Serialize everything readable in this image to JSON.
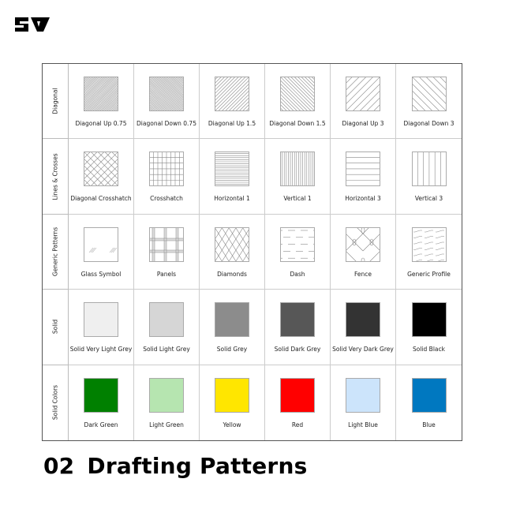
{
  "logo": {
    "text": "SA",
    "icon": "sa-logo-icon"
  },
  "title": {
    "number": "02",
    "text": "Drafting Patterns"
  },
  "rows": [
    {
      "label": "Diagonal",
      "items": [
        {
          "name": "Diagonal Up 0.75",
          "pattern": "diag-up",
          "spacing": 0.75
        },
        {
          "name": "Diagonal Down 0.75",
          "pattern": "diag-down",
          "spacing": 0.75
        },
        {
          "name": "Diagonal Up 1.5",
          "pattern": "diag-up",
          "spacing": 1.5
        },
        {
          "name": "Diagonal Down 1.5",
          "pattern": "diag-down",
          "spacing": 1.5
        },
        {
          "name": "Diagonal Up 3",
          "pattern": "diag-up",
          "spacing": 3
        },
        {
          "name": "Diagonal Down 3",
          "pattern": "diag-down",
          "spacing": 3
        }
      ]
    },
    {
      "label": "Lines & Crosses",
      "items": [
        {
          "name": "Diagonal Crosshatch",
          "pattern": "diag-cross"
        },
        {
          "name": "Crosshatch",
          "pattern": "crosshatch"
        },
        {
          "name": "Horizontal 1",
          "pattern": "horizontal",
          "spacing": 1
        },
        {
          "name": "Vertical 1",
          "pattern": "vertical",
          "spacing": 1
        },
        {
          "name": "Horizontal 3",
          "pattern": "horizontal",
          "spacing": 3
        },
        {
          "name": "Vertical 3",
          "pattern": "vertical",
          "spacing": 3
        }
      ]
    },
    {
      "label": "Generic Patterns",
      "items": [
        {
          "name": "Glass Symbol",
          "pattern": "glass"
        },
        {
          "name": "Panels",
          "pattern": "panels"
        },
        {
          "name": "Diamonds",
          "pattern": "diamonds"
        },
        {
          "name": "Dash",
          "pattern": "dash"
        },
        {
          "name": "Fence",
          "pattern": "fence"
        },
        {
          "name": "Generic Profile",
          "pattern": "profile"
        }
      ]
    },
    {
      "label": "Solid",
      "items": [
        {
          "name": "Solid Very Light Grey",
          "pattern": "solid",
          "color": "#efefef"
        },
        {
          "name": "Solid Light Grey",
          "pattern": "solid",
          "color": "#d6d6d6"
        },
        {
          "name": "Solid Grey",
          "pattern": "solid",
          "color": "#8c8c8c"
        },
        {
          "name": "Solid Dark Grey",
          "pattern": "solid",
          "color": "#575757"
        },
        {
          "name": "Solid Very Dark Grey",
          "pattern": "solid",
          "color": "#333333"
        },
        {
          "name": "Solid Black",
          "pattern": "solid",
          "color": "#000000"
        }
      ]
    },
    {
      "label": "Solid Colors",
      "items": [
        {
          "name": "Dark Green",
          "pattern": "solid",
          "color": "#008000"
        },
        {
          "name": "Light Green",
          "pattern": "solid",
          "color": "#b6e5b0"
        },
        {
          "name": "Yellow",
          "pattern": "solid",
          "color": "#ffe600"
        },
        {
          "name": "Red",
          "pattern": "solid",
          "color": "#ff0000"
        },
        {
          "name": "Light Blue",
          "pattern": "solid",
          "color": "#cce4fb"
        },
        {
          "name": "Blue",
          "pattern": "solid",
          "color": "#0078c0"
        }
      ]
    }
  ]
}
